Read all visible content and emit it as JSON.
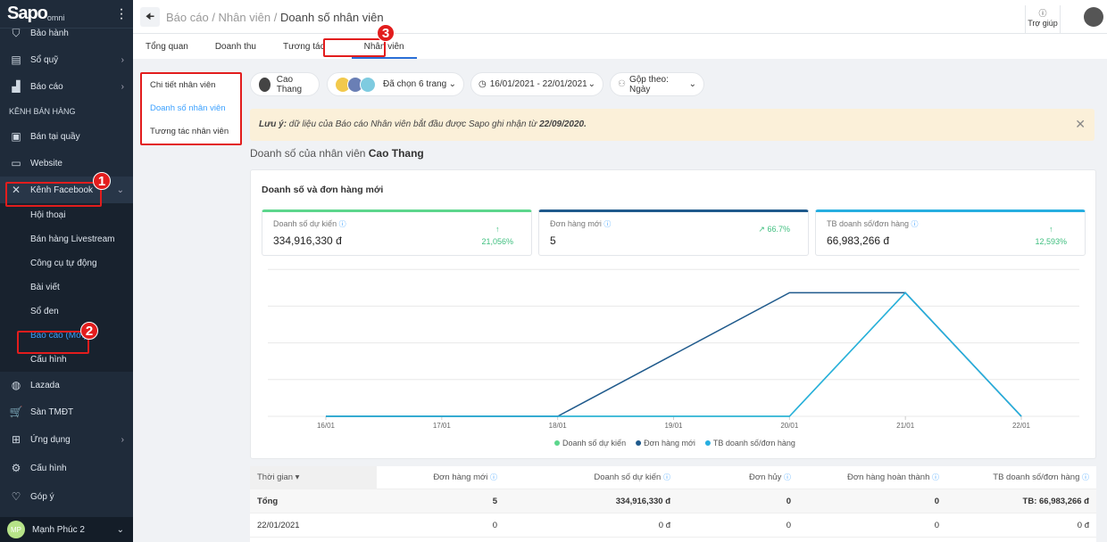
{
  "sidebar": {
    "logo": "Sapo",
    "logo_sub": "omni",
    "items_top": [
      {
        "label": "Bảo hành",
        "icon": "shield-icon"
      },
      {
        "label": "Sổ quỹ",
        "icon": "cash-icon"
      },
      {
        "label": "Báo cáo",
        "icon": "chart-icon"
      }
    ],
    "section": "KÊNH BÁN HÀNG",
    "channels": [
      {
        "label": "Bán tại quầy",
        "icon": "register-icon"
      },
      {
        "label": "Website",
        "icon": "monitor-icon"
      },
      {
        "label": "Kênh Facebook",
        "icon": "network-icon"
      }
    ],
    "facebook_sub": [
      "Hội thoại",
      "Bán hàng Livestream",
      "Công cụ tự động",
      "Bài viết",
      "Sổ đen",
      "Báo cáo (Mới)",
      "Cấu hình"
    ],
    "items_bottom": [
      {
        "label": "Lazada",
        "icon": "lazada-icon"
      },
      {
        "label": "Sàn TMĐT",
        "icon": "cart-icon"
      },
      {
        "label": "Ứng dụng",
        "icon": "apps-icon"
      },
      {
        "label": "Cấu hình",
        "icon": "gear-icon"
      },
      {
        "label": "Góp ý",
        "icon": "feedback-icon"
      }
    ],
    "user": {
      "initials": "MP",
      "name": "Mạnh Phúc 2"
    }
  },
  "annotations": [
    "1",
    "2",
    "3"
  ],
  "header": {
    "breadcrumb": [
      "Báo cáo",
      "Nhân viên",
      "Doanh số nhân viên"
    ],
    "help": "Trợ giúp"
  },
  "tabs": [
    "Tổng quan",
    "Doanh thu",
    "Tương tác",
    "Nhân viên"
  ],
  "left_menu": [
    "Chi tiết nhân viên",
    "Doanh số nhân viên",
    "Tương tác nhân viên"
  ],
  "filters": {
    "staff": "Cao Thang",
    "pages": "Đã chọn 6 trang",
    "dates": "16/01/2021 - 22/01/2021",
    "group": "Gộp theo: Ngày"
  },
  "notice": {
    "prefix": "Lưu ý:",
    "text": " dữ liệu của Báo cáo Nhân viên bắt đầu được Sapo ghi nhận từ ",
    "date": "22/09/2020."
  },
  "heading": {
    "prefix": "Doanh số của nhân viên ",
    "name": "Cao Thang"
  },
  "card": {
    "title": "Doanh số và đơn hàng mới",
    "kpis": [
      {
        "label": "Doanh số dự kiến",
        "value": "334,916,330 đ",
        "change": "21,056%",
        "arrow": "↑",
        "color": "#5cd68c"
      },
      {
        "label": "Đơn hàng mới",
        "value": "5",
        "change": "66.7%",
        "arrow": "↗",
        "color": "#1f5a8c"
      },
      {
        "label": "TB doanh số/đơn hàng",
        "value": "66,983,266 đ",
        "change": "12,593%",
        "arrow": "↑",
        "color": "#27aee0"
      }
    ]
  },
  "chart_data": {
    "type": "line",
    "categories": [
      "16/01",
      "17/01",
      "18/01",
      "19/01",
      "20/01",
      "21/01",
      "22/01"
    ],
    "series": [
      {
        "name": "Doanh số dự kiến",
        "color": "#5cd68c",
        "values": [
          0,
          0,
          0,
          0,
          0,
          334916330,
          0
        ]
      },
      {
        "name": "Đơn hàng mới",
        "color": "#1f5a8c",
        "values": [
          0,
          0,
          0,
          1,
          2,
          2,
          0
        ]
      },
      {
        "name": "TB doanh số/đơn hàng",
        "color": "#27aee0",
        "values": [
          0,
          0,
          0,
          0,
          0,
          66983266,
          0
        ]
      }
    ],
    "legend": "bottom",
    "grid": true
  },
  "table": {
    "headers": [
      "Thời gian ▾",
      "Đơn hàng mới",
      "Doanh số dự kiến",
      "Đơn hủy",
      "Đơn hàng hoàn thành",
      "TB doanh số/đơn hàng"
    ],
    "rows": [
      [
        "Tổng",
        "5",
        "334,916,330 đ",
        "0",
        "0",
        "TB: 66,983,266 đ"
      ],
      [
        "22/01/2021",
        "0",
        "0 đ",
        "0",
        "0",
        "0 đ"
      ]
    ]
  }
}
